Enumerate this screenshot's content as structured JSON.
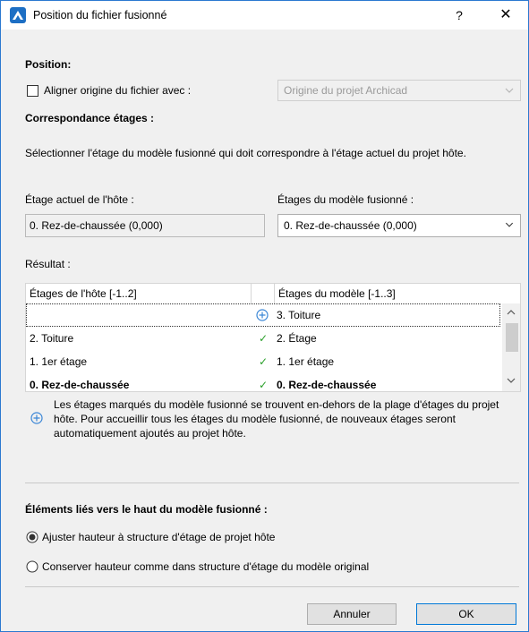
{
  "window": {
    "title": "Position du fichier fusionné",
    "help_label": "?",
    "close_label": "✕"
  },
  "position": {
    "heading": "Position:",
    "align_label": "Aligner origine du fichier avec :",
    "align_checked": false,
    "origin_value": "Origine du projet Archicad"
  },
  "stories": {
    "heading": "Correspondance étages :",
    "description": "Sélectionner l'étage du modèle fusionné qui doit correspondre à l'étage actuel du projet hôte.",
    "host_label": "Étage actuel de l'hôte :",
    "host_value": "0. Rez-de-chaussée (0,000)",
    "merged_label": "Étages du modèle fusionné :",
    "merged_value": "0. Rez-de-chaussée (0,000)"
  },
  "result": {
    "heading": "Résultat :",
    "col_host": "Étages de l'hôte [-1..2]",
    "col_model": "Étages du modèle [-1..3]",
    "rows": [
      {
        "host": "",
        "status": "plus",
        "model": "3. Toiture"
      },
      {
        "host": "2. Toiture",
        "status": "✓",
        "model": "2. Étage"
      },
      {
        "host": "1. 1er étage",
        "status": "✓",
        "model": "1. 1er étage"
      },
      {
        "host": "0. Rez-de-chaussée",
        "status": "✓",
        "model": "0. Rez-de-chaussée"
      }
    ],
    "note": "Les étages marqués du modèle fusionné se trouvent en-dehors de la plage d'étages du projet hôte. Pour accueillir tous les étages du modèle fusionné, de nouveaux étages seront automatiquement ajoutés au projet hôte."
  },
  "linked": {
    "heading": "Éléments liés vers le haut du modèle fusionné :",
    "option1": "Ajuster hauteur à structure d'étage de projet hôte",
    "option2": "Conserver hauteur comme dans structure d'étage du modèle original",
    "selected_option": 1
  },
  "buttons": {
    "cancel": "Annuler",
    "ok": "OK"
  },
  "colors": {
    "accent": "#0078d7",
    "check": "#2aa02a",
    "plus": "#3a86d6"
  }
}
